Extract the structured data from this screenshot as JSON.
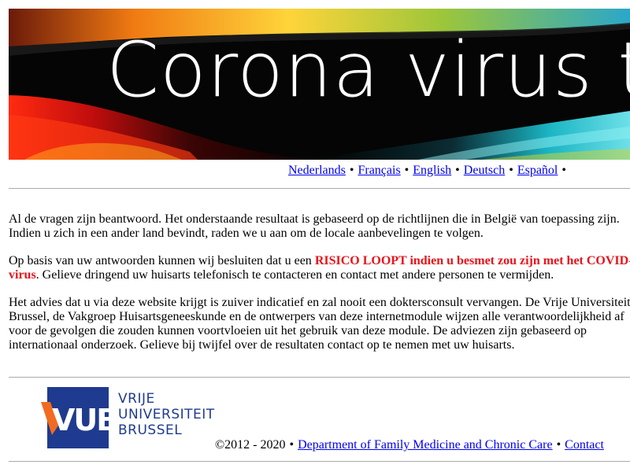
{
  "banner": {
    "title": "Corona virus test"
  },
  "languages": [
    {
      "label": "Nederlands"
    },
    {
      "label": "Français"
    },
    {
      "label": "English"
    },
    {
      "label": "Deutsch"
    },
    {
      "label": "Español"
    }
  ],
  "separator": "•",
  "content": {
    "p1": "Al de vragen zijn beantwoord. Het onderstaande resultaat is gebaseerd op de richtlijnen die in België van toepassing zijn. Indien u zich in een ander land bevindt, raden we u aan om de locale aanbevelingen te volgen.",
    "p2_before": "Op basis van uw antwoorden kunnen wij besluiten dat u een ",
    "p2_warning": "RISICO LOOPT indien u besmet zou zijn met het COVID-19 virus",
    "p2_after": ". Gelieve dringend uw huisarts telefonisch te contacteren en contact met andere personen te vermijden.",
    "p3": "Het advies dat u via deze website krijgt is zuiver indicatief en zal nooit een doktersconsult vervangen. De Vrije Universiteit Brussel, de Vakgroep Huisartsgeneeskunde en de ontwerpers van deze internetmodule wijzen alle verantwoordelijkheid af voor de gevolgen die zouden kunnen voortvloeien uit het gebruik van deze module. De adviezen zijn gebaseerd op internationaal onderzoek. Gelieve bij twijfel over de resultaten contact op te nemen met uw huisarts."
  },
  "footer": {
    "logo_letters": "VUB",
    "university_lines": [
      "VRIJE",
      "UNIVERSITEIT",
      "BRUSSEL"
    ],
    "copyright": "©2012 - 2020",
    "department_link": "Department of Family Medicine and Chronic Care",
    "contact_link": "Contact"
  },
  "colors": {
    "link": "#0000ee",
    "warning": "#e8131a",
    "vub_blue": "#1f3b8f",
    "vub_orange": "#f26b21"
  },
  "icons": {
    "banner_graphic": "abstract-wave-banner",
    "logo": "vub-logo"
  }
}
